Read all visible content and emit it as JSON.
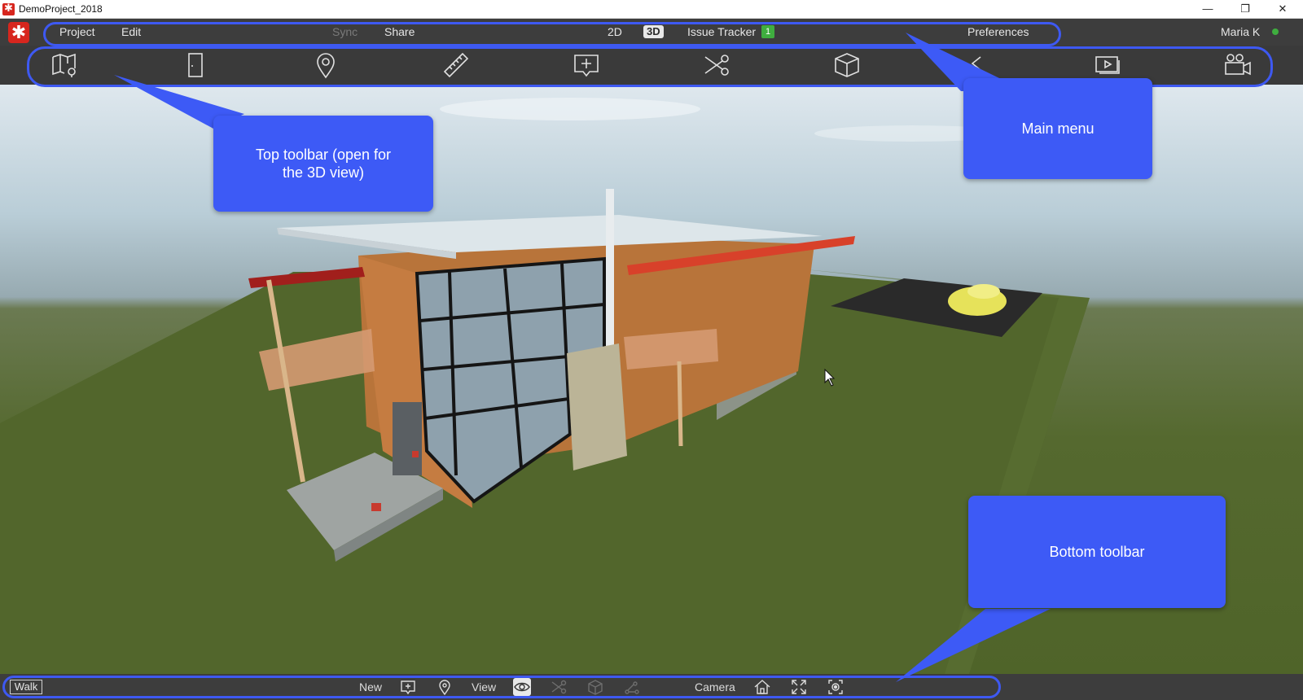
{
  "window": {
    "title": "DemoProject_2018",
    "minimize_icon": "minimize-icon",
    "restore_icon": "restore-icon",
    "close_icon": "close-icon"
  },
  "menu": {
    "project": "Project",
    "edit": "Edit",
    "sync": "Sync",
    "share": "Share",
    "view_2d": "2D",
    "view_3d": "3D",
    "issue_tracker": "Issue Tracker",
    "issue_count": "1",
    "preferences": "Preferences",
    "user": "Maria K"
  },
  "toolbar": {
    "icons": [
      "map-pin-icon",
      "door-icon",
      "location-pin-icon",
      "ruler-icon",
      "add-comment-icon",
      "scissors-icon",
      "cube-icon",
      "play-arrow-icon",
      "slides-icon",
      "video-camera-icon"
    ]
  },
  "callouts": {
    "top_toolbar": "Top toolbar (open for the 3D view)",
    "main_menu": "Main menu",
    "bottom_toolbar": "Bottom toolbar"
  },
  "bottombar": {
    "walk": "Walk",
    "new": "New",
    "view": "View",
    "camera": "Camera",
    "icons": [
      "add-plus-icon",
      "pin-icon",
      "eye-icon",
      "scissors-icon",
      "box-icon",
      "nodes-icon",
      "home-icon",
      "fullscreen-icon",
      "focus-icon"
    ]
  },
  "colors": {
    "accent": "#3d5af6",
    "status_online": "#3fae3f",
    "brand": "#d7261e"
  }
}
